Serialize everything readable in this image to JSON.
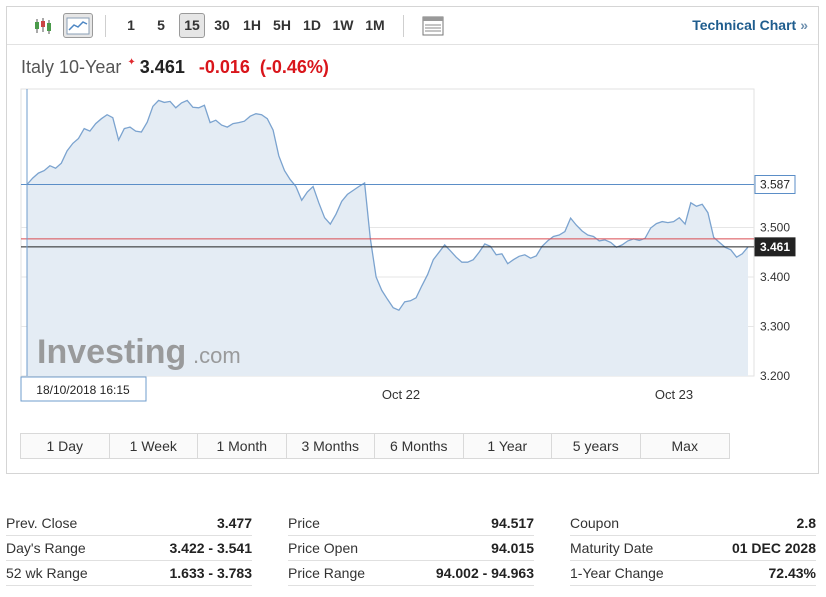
{
  "toolbar": {
    "intervals": [
      "1",
      "5",
      "15",
      "30",
      "1H",
      "5H",
      "1D",
      "1W",
      "1M"
    ],
    "active_interval": "15",
    "technical_chart_label": "Technical Chart",
    "technical_chart_arrow": "»",
    "icons": [
      "candlestick-chart-icon",
      "area-chart-icon",
      "table-icon"
    ]
  },
  "quote": {
    "name": "Italy 10-Year",
    "star": "✦",
    "price": "3.461",
    "change": "-0.016",
    "change_pct": "(-0.46%)"
  },
  "chart_data": {
    "type": "area",
    "x_ticks": [
      "Oct 22",
      "Oct 23"
    ],
    "y_ticks": [
      "3.587",
      "3.500",
      "3.400",
      "3.300",
      "3.200"
    ],
    "ylim": [
      3.2,
      3.78
    ],
    "crosshair_label": "18/10/2018 16:15",
    "reference_lines": [
      {
        "name": "crosshair",
        "value": 3.587,
        "label": "3.587",
        "color": "#5b8ec7"
      },
      {
        "name": "previous-close",
        "value": 3.477,
        "color": "#d94b52"
      },
      {
        "name": "last-price",
        "value": 3.461,
        "label": "3.461",
        "color": "#222222"
      }
    ],
    "values": [
      3.587,
      3.6,
      3.61,
      3.615,
      3.625,
      3.62,
      3.63,
      3.655,
      3.67,
      3.68,
      3.7,
      3.695,
      3.71,
      3.72,
      3.728,
      3.722,
      3.677,
      3.7,
      3.703,
      3.695,
      3.693,
      3.713,
      3.745,
      3.757,
      3.753,
      3.755,
      3.742,
      3.752,
      3.757,
      3.743,
      3.742,
      3.747,
      3.712,
      3.717,
      3.707,
      3.703,
      3.71,
      3.712,
      3.715,
      3.725,
      3.73,
      3.728,
      3.72,
      3.697,
      3.645,
      3.615,
      3.597,
      3.583,
      3.555,
      3.572,
      3.583,
      3.55,
      3.52,
      3.507,
      3.527,
      3.553,
      3.567,
      3.575,
      3.583,
      3.59,
      3.478,
      3.4,
      3.373,
      3.355,
      3.338,
      3.333,
      3.35,
      3.352,
      3.358,
      3.382,
      3.405,
      3.435,
      3.45,
      3.465,
      3.453,
      3.44,
      3.43,
      3.43,
      3.435,
      3.45,
      3.467,
      3.462,
      3.445,
      3.447,
      3.427,
      3.435,
      3.442,
      3.445,
      3.438,
      3.443,
      3.462,
      3.473,
      3.482,
      3.485,
      3.492,
      3.519,
      3.505,
      3.493,
      3.485,
      3.482,
      3.473,
      3.475,
      3.47,
      3.46,
      3.465,
      3.473,
      3.477,
      3.474,
      3.478,
      3.499,
      3.508,
      3.512,
      3.51,
      3.512,
      3.52,
      3.507,
      3.55,
      3.543,
      3.547,
      3.53,
      3.48,
      3.47,
      3.46,
      3.455,
      3.44,
      3.447,
      3.461
    ],
    "colors": {
      "line": "#7ba3cf",
      "fill": "#e4ecf4",
      "grid": "#e6e6e6"
    }
  },
  "watermark": {
    "brand": "Investing",
    "suffix": ".com"
  },
  "range_buttons": [
    "1 Day",
    "1 Week",
    "1 Month",
    "3 Months",
    "6 Months",
    "1 Year",
    "5 years",
    "Max"
  ],
  "stats": [
    [
      {
        "label": "Prev. Close",
        "value": "3.477"
      },
      {
        "label": "Day's Range",
        "value": "3.422 - 3.541"
      },
      {
        "label": "52 wk Range",
        "value": "1.633 - 3.783"
      }
    ],
    [
      {
        "label": "Price",
        "value": "94.517"
      },
      {
        "label": "Price Open",
        "value": "94.015"
      },
      {
        "label": "Price Range",
        "value": "94.002 - 94.963"
      }
    ],
    [
      {
        "label": "Coupon",
        "value": "2.8"
      },
      {
        "label": "Maturity Date",
        "value": "01 DEC 2028"
      },
      {
        "label": "1-Year Change",
        "value": "72.43%"
      }
    ]
  ]
}
